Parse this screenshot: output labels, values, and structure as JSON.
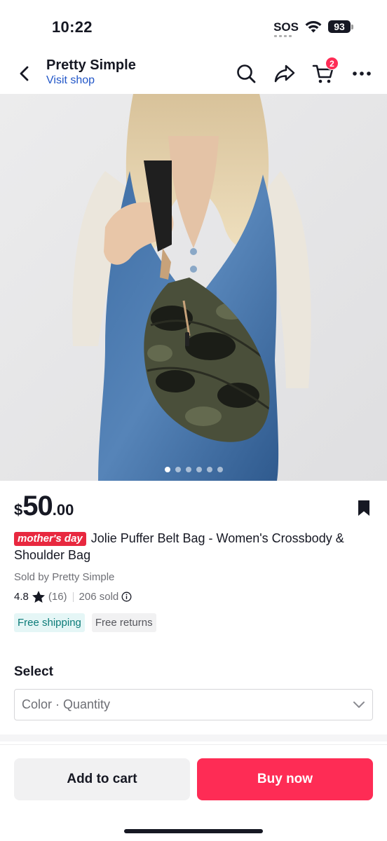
{
  "status_bar": {
    "time": "10:22",
    "sos": "SOS",
    "battery": "93",
    "icons": [
      "wifi-icon",
      "battery-icon"
    ]
  },
  "navbar": {
    "shop_name": "Pretty Simple",
    "visit_shop": "Visit shop",
    "cart_count": "2",
    "icons": [
      "back-arrow-icon",
      "search-icon",
      "share-icon",
      "cart-icon",
      "more-icon"
    ]
  },
  "gallery": {
    "total_images": 6,
    "active_index": 0,
    "image_description": "model in denim dress wearing camo puffer crossbody belt bag"
  },
  "product": {
    "price_currency": "$",
    "price_main": "50",
    "price_cents": ".00",
    "promo_tag": "mother's day",
    "title": "Jolie Puffer Belt Bag - Women's Crossbody & Shoulder Bag",
    "sold_by": "Sold by Pretty Simple",
    "rating": "4.8",
    "review_count": "(16)",
    "sold_count": "206 sold",
    "badges": {
      "shipping": "Free shipping",
      "returns": "Free returns"
    }
  },
  "select": {
    "label": "Select",
    "placeholder": "Color · Quantity"
  },
  "actions": {
    "add_to_cart": "Add to cart",
    "buy_now": "Buy now"
  },
  "colors": {
    "accent": "#fe2c55",
    "link": "#2156c8",
    "promo": "#e8283f",
    "shipping_text": "#0b7b78",
    "shipping_bg": "#e5f6f6"
  }
}
